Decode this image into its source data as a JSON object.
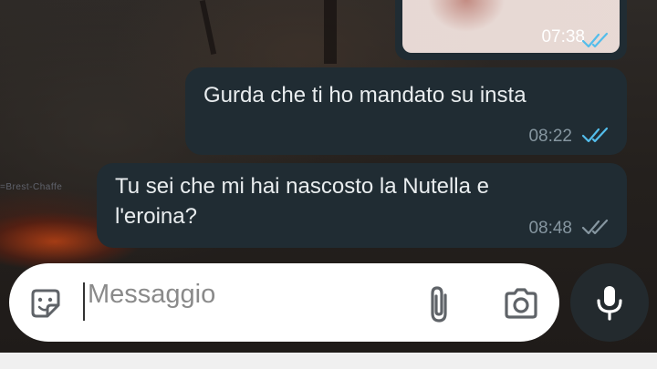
{
  "messages": [
    {
      "type": "image",
      "time": "07:38",
      "status": "read",
      "tick_color": "#53bdeb"
    },
    {
      "type": "text",
      "text": "Gurda che ti ho mandato  su insta",
      "time": "08:22",
      "status": "read",
      "tick_color": "#53bdeb"
    },
    {
      "type": "text",
      "lines": [
        "Tu sei che mi hai nascosto la Nutella e",
        "l'eroina?"
      ],
      "time": "08:48",
      "status": "delivered",
      "tick_color": "#8696a0"
    }
  ],
  "wallpaper": {
    "watermark": "=Brest-Chaffe"
  },
  "composer": {
    "placeholder": "Messaggio",
    "icons": {
      "emoji": "sticker-icon",
      "attach": "paperclip-icon",
      "camera": "camera-icon",
      "send": "mic-icon"
    }
  },
  "colors": {
    "bubble": "#202c33",
    "text": "#e9edef",
    "meta": "#8696a0",
    "read_tick": "#53bdeb"
  }
}
